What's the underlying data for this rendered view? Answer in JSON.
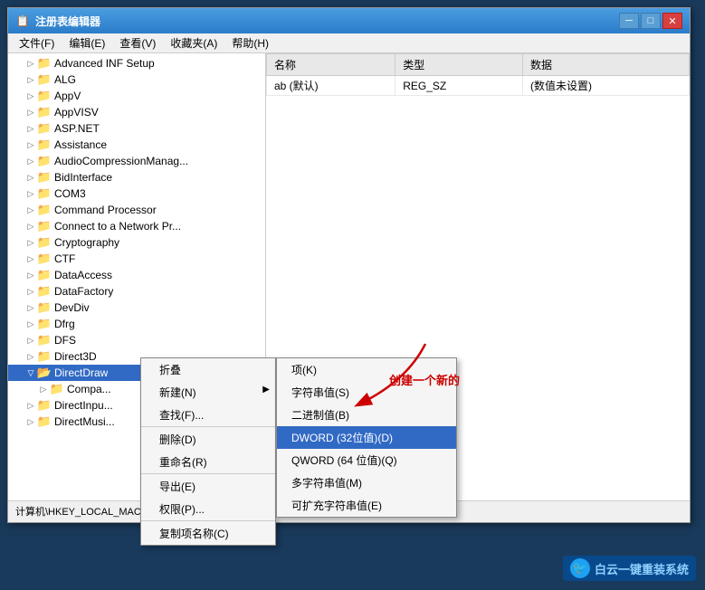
{
  "window": {
    "title": "注册表编辑器",
    "titlebar_icon": "📋"
  },
  "titlebar_buttons": {
    "minimize": "─",
    "maximize": "□",
    "close": "✕"
  },
  "menubar": {
    "items": [
      {
        "label": "文件(F)"
      },
      {
        "label": "编辑(E)"
      },
      {
        "label": "查看(V)"
      },
      {
        "label": "收藏夹(A)"
      },
      {
        "label": "帮助(H)"
      }
    ]
  },
  "tree_items": [
    {
      "label": "Advanced INF Setup",
      "indent": 1,
      "expanded": false
    },
    {
      "label": "ALG",
      "indent": 1,
      "expanded": false
    },
    {
      "label": "AppV",
      "indent": 1,
      "expanded": false
    },
    {
      "label": "AppVISV",
      "indent": 1,
      "expanded": false
    },
    {
      "label": "ASP.NET",
      "indent": 1,
      "expanded": false
    },
    {
      "label": "Assistance",
      "indent": 1,
      "expanded": false
    },
    {
      "label": "AudioCompressionManag...",
      "indent": 1,
      "expanded": false
    },
    {
      "label": "BidInterface",
      "indent": 1,
      "expanded": false
    },
    {
      "label": "COM3",
      "indent": 1,
      "expanded": false
    },
    {
      "label": "Command Processor",
      "indent": 1,
      "expanded": false
    },
    {
      "label": "Connect to a Network Pr...",
      "indent": 1,
      "expanded": false
    },
    {
      "label": "Cryptography",
      "indent": 1,
      "expanded": false
    },
    {
      "label": "CTF",
      "indent": 1,
      "expanded": false
    },
    {
      "label": "DataAccess",
      "indent": 1,
      "expanded": false
    },
    {
      "label": "DataFactory",
      "indent": 1,
      "expanded": false
    },
    {
      "label": "DevDiv",
      "indent": 1,
      "expanded": false
    },
    {
      "label": "Dfrg",
      "indent": 1,
      "expanded": false
    },
    {
      "label": "DFS",
      "indent": 1,
      "expanded": false
    },
    {
      "label": "Direct3D",
      "indent": 1,
      "expanded": false
    },
    {
      "label": "DirectDraw",
      "indent": 1,
      "expanded": true,
      "selected": true
    },
    {
      "label": "Compa...",
      "indent": 2,
      "expanded": false
    },
    {
      "label": "DirectInpu...",
      "indent": 1,
      "expanded": false
    },
    {
      "label": "DirectMusi...",
      "indent": 1,
      "expanded": false
    }
  ],
  "table": {
    "headers": [
      "名称",
      "类型",
      "数据"
    ],
    "rows": [
      {
        "name": "ab (默认)",
        "type": "REG_SZ",
        "data": "(数值未设置)"
      }
    ]
  },
  "status_bar": {
    "text": "计算机\\HKEY_LOCAL_MACHINE\\"
  },
  "context_menu": {
    "items": [
      {
        "label": "折叠",
        "key": "",
        "separator": false
      },
      {
        "label": "新建(N)",
        "key": "",
        "separator": false,
        "has_submenu": true
      },
      {
        "label": "查找(F)...",
        "key": "",
        "separator": true
      },
      {
        "label": "删除(D)",
        "key": "",
        "separator": false
      },
      {
        "label": "重命名(R)",
        "key": "",
        "separator": true
      },
      {
        "label": "导出(E)",
        "key": "",
        "separator": false
      },
      {
        "label": "权限(P)...",
        "key": "",
        "separator": true
      },
      {
        "label": "复制项名称(C)",
        "key": "",
        "separator": false
      }
    ]
  },
  "submenu": {
    "items": [
      {
        "label": "项(K)",
        "separator": false
      },
      {
        "label": "字符串值(S)",
        "separator": false
      },
      {
        "label": "二进制值(B)",
        "separator": false
      },
      {
        "label": "DWORD (32位值)(D)",
        "separator": false,
        "highlighted": true
      },
      {
        "label": "QWORD (64 位值)(Q)",
        "separator": false
      },
      {
        "label": "多字符串值(M)",
        "separator": false
      },
      {
        "label": "可扩充字符串值(E)",
        "separator": false
      }
    ]
  },
  "annotation": {
    "text": "创建一个新的"
  },
  "watermark": {
    "text": "白云一键重装系统",
    "url": "baiyunxitong.com"
  }
}
